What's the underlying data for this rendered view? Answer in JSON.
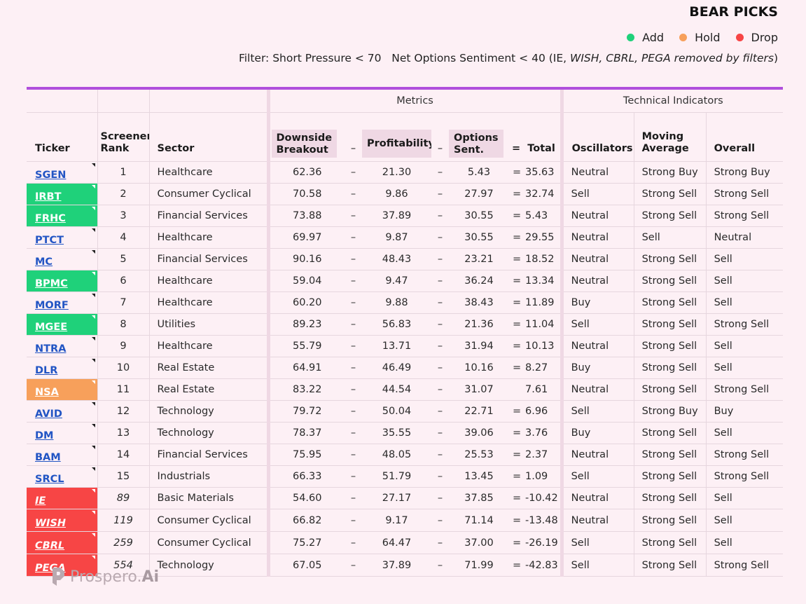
{
  "title": "BEAR PICKS",
  "legend": [
    {
      "label": "Add",
      "color": "#1fd17a"
    },
    {
      "label": "Hold",
      "color": "#f7a05b"
    },
    {
      "label": "Drop",
      "color": "#f74545"
    }
  ],
  "filter": {
    "prefix": "Filter: Short Pressure < 70   Net Options Sentiment < 40 (IE, ",
    "removed": "WISH, CBRL, PEGA removed by filters",
    "suffix": ")"
  },
  "groups": {
    "metrics": "Metrics",
    "technical": "Technical Indicators"
  },
  "headers": {
    "ticker": "Ticker",
    "rank_l1": "Screener",
    "rank_l2": "Rank",
    "sector": "Sector",
    "downside_l1": "Downside",
    "downside_l2": "Breakout",
    "dash": "–",
    "profitability": "Profitability",
    "options_l1": "Options",
    "options_l2": "Sent.",
    "eq": "=",
    "total": "Total",
    "oscillators": "Oscillators",
    "moving_l1": "Moving",
    "moving_l2": "Average",
    "overall": "Overall"
  },
  "rows": [
    {
      "ticker": "SGEN",
      "status": "none",
      "rank": "1",
      "sector": "Healthcare",
      "downside": "62.36",
      "profit": "21.30",
      "options": "5.43",
      "eq": "=",
      "total": "35.63",
      "osc": "Neutral",
      "ma": "Strong Buy",
      "overall": "Strong Buy"
    },
    {
      "ticker": "IRBT",
      "status": "add",
      "rank": "2",
      "sector": "Consumer Cyclical",
      "downside": "70.58",
      "profit": "9.86",
      "options": "27.97",
      "eq": "=",
      "total": "32.74",
      "osc": "Sell",
      "ma": "Strong Sell",
      "overall": "Strong Sell"
    },
    {
      "ticker": "FRHC",
      "status": "add",
      "rank": "3",
      "sector": "Financial Services",
      "downside": "73.88",
      "profit": "37.89",
      "options": "30.55",
      "eq": "=",
      "total": "5.43",
      "osc": "Neutral",
      "ma": "Strong Sell",
      "overall": "Strong Sell"
    },
    {
      "ticker": "PTCT",
      "status": "none",
      "rank": "4",
      "sector": "Healthcare",
      "downside": "69.97",
      "profit": "9.87",
      "options": "30.55",
      "eq": "=",
      "total": "29.55",
      "osc": "Neutral",
      "ma": "Sell",
      "overall": "Neutral"
    },
    {
      "ticker": "MC",
      "status": "none",
      "rank": "5",
      "sector": "Financial Services",
      "downside": "90.16",
      "profit": "48.43",
      "options": "23.21",
      "eq": "=",
      "total": "18.52",
      "osc": "Neutral",
      "ma": "Strong Sell",
      "overall": "Sell"
    },
    {
      "ticker": "BPMC",
      "status": "add",
      "rank": "6",
      "sector": "Healthcare",
      "downside": "59.04",
      "profit": "9.47",
      "options": "36.24",
      "eq": "=",
      "total": "13.34",
      "osc": "Neutral",
      "ma": "Strong Sell",
      "overall": "Sell"
    },
    {
      "ticker": "MORF",
      "status": "none",
      "rank": "7",
      "sector": "Healthcare",
      "downside": "60.20",
      "profit": "9.88",
      "options": "38.43",
      "eq": "=",
      "total": "11.89",
      "osc": "Buy",
      "ma": "Strong Sell",
      "overall": "Sell"
    },
    {
      "ticker": "MGEE",
      "status": "add",
      "rank": "8",
      "sector": "Utilities",
      "downside": "89.23",
      "profit": "56.83",
      "options": "21.36",
      "eq": "=",
      "total": "11.04",
      "osc": "Sell",
      "ma": "Strong Sell",
      "overall": "Strong Sell"
    },
    {
      "ticker": "NTRA",
      "status": "none",
      "rank": "9",
      "sector": "Healthcare",
      "downside": "55.79",
      "profit": "13.71",
      "options": "31.94",
      "eq": "=",
      "total": "10.13",
      "osc": "Neutral",
      "ma": "Strong Sell",
      "overall": "Sell"
    },
    {
      "ticker": "DLR",
      "status": "none",
      "rank": "10",
      "sector": "Real Estate",
      "downside": "64.91",
      "profit": "46.49",
      "options": "10.16",
      "eq": "=",
      "total": "8.27",
      "osc": "Buy",
      "ma": "Strong Sell",
      "overall": "Sell"
    },
    {
      "ticker": "NSA",
      "status": "hold",
      "rank": "11",
      "sector": "Real Estate",
      "downside": "83.22",
      "profit": "44.54",
      "options": "31.07",
      "eq": "",
      "total": "7.61",
      "osc": "Neutral",
      "ma": "Strong Sell",
      "overall": "Strong Sell"
    },
    {
      "ticker": "AVID",
      "status": "none",
      "rank": "12",
      "sector": "Technology",
      "downside": "79.72",
      "profit": "50.04",
      "options": "22.71",
      "eq": "=",
      "total": "6.96",
      "osc": "Sell",
      "ma": "Strong Buy",
      "overall": "Buy"
    },
    {
      "ticker": "DM",
      "status": "none",
      "rank": "13",
      "sector": "Technology",
      "downside": "78.37",
      "profit": "35.55",
      "options": "39.06",
      "eq": "=",
      "total": "3.76",
      "osc": "Buy",
      "ma": "Strong Sell",
      "overall": "Sell"
    },
    {
      "ticker": "BAM",
      "status": "none",
      "rank": "14",
      "sector": "Financial Services",
      "downside": "75.95",
      "profit": "48.05",
      "options": "25.53",
      "eq": "=",
      "total": "2.37",
      "osc": "Neutral",
      "ma": "Strong Sell",
      "overall": "Strong Sell"
    },
    {
      "ticker": "SRCL",
      "status": "none",
      "rank": "15",
      "sector": "Industrials",
      "downside": "66.33",
      "profit": "51.79",
      "options": "13.45",
      "eq": "=",
      "total": "1.09",
      "osc": "Sell",
      "ma": "Strong Sell",
      "overall": "Strong Sell"
    },
    {
      "ticker": "IE",
      "status": "drop",
      "rank": "89",
      "sector": "Basic Materials",
      "downside": "54.60",
      "profit": "27.17",
      "options": "37.85",
      "eq": "=",
      "total": "-10.42",
      "osc": "Neutral",
      "ma": "Strong Sell",
      "overall": "Sell"
    },
    {
      "ticker": "WISH",
      "status": "drop",
      "rank": "119",
      "sector": "Consumer Cyclical",
      "downside": "66.82",
      "profit": "9.17",
      "options": "71.14",
      "eq": "=",
      "total": "-13.48",
      "osc": "Neutral",
      "ma": "Strong Sell",
      "overall": "Sell"
    },
    {
      "ticker": "CBRL",
      "status": "drop",
      "rank": "259",
      "sector": "Consumer Cyclical",
      "downside": "75.27",
      "profit": "64.47",
      "options": "37.00",
      "eq": "=",
      "total": "-26.19",
      "osc": "Sell",
      "ma": "Strong Sell",
      "overall": "Sell"
    },
    {
      "ticker": "PEGA",
      "status": "drop",
      "rank": "554",
      "sector": "Technology",
      "downside": "67.05",
      "profit": "37.89",
      "options": "71.99",
      "eq": "=",
      "total": "-42.83",
      "osc": "Sell",
      "ma": "Strong Sell",
      "overall": "Strong Sell"
    }
  ],
  "logo": {
    "text": "Prospero.",
    "suffix": "Ai"
  }
}
